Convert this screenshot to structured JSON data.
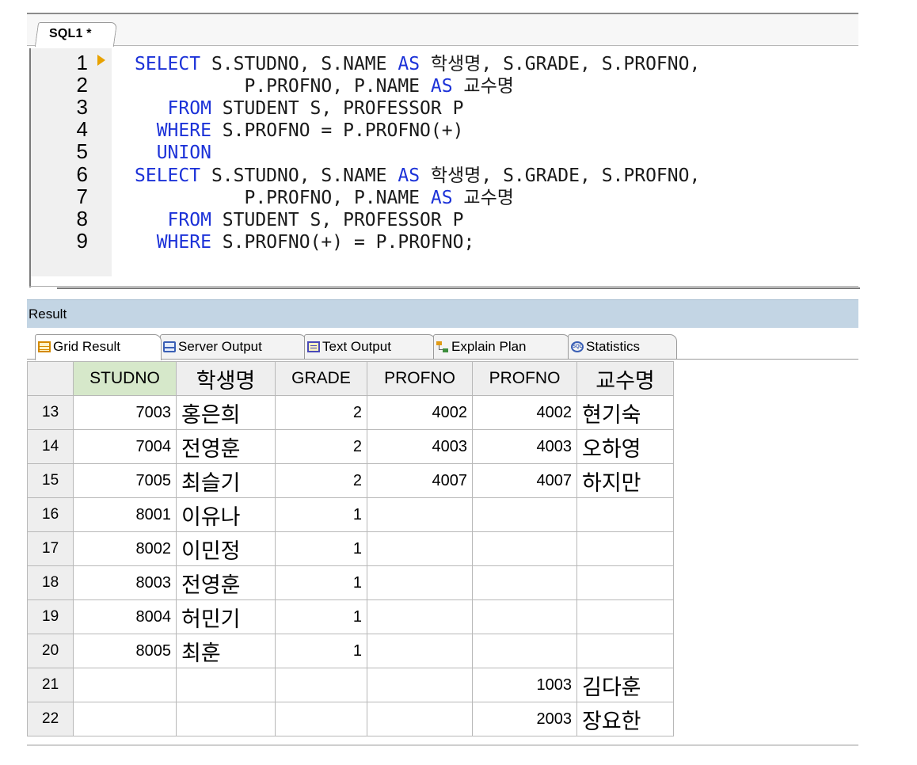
{
  "editor": {
    "tab_label": "SQL1 *",
    "line_numbers": [
      "1",
      "2",
      "3",
      "4",
      "5",
      "6",
      "7",
      "8",
      "9"
    ],
    "lines": [
      [
        {
          "t": "SELECT",
          "kw": true
        },
        {
          "t": " S.STUDNO, S.NAME "
        },
        {
          "t": "AS",
          "kw": true
        },
        {
          "t": " 학생명, S.GRADE, S.PROFNO,"
        }
      ],
      [
        {
          "t": "          P.PROFNO, P.NAME "
        },
        {
          "t": "AS",
          "kw": true
        },
        {
          "t": " 교수명"
        }
      ],
      [
        {
          "t": "   "
        },
        {
          "t": "FROM",
          "kw": true
        },
        {
          "t": " STUDENT S, PROFESSOR P"
        }
      ],
      [
        {
          "t": "  "
        },
        {
          "t": "WHERE",
          "kw": true
        },
        {
          "t": " S.PROFNO = P.PROFNO(+)"
        }
      ],
      [
        {
          "t": "  "
        },
        {
          "t": "UNION",
          "kw": true
        }
      ],
      [
        {
          "t": "SELECT",
          "kw": true
        },
        {
          "t": " S.STUDNO, S.NAME "
        },
        {
          "t": "AS",
          "kw": true
        },
        {
          "t": " 학생명, S.GRADE, S.PROFNO,"
        }
      ],
      [
        {
          "t": "          P.PROFNO, P.NAME "
        },
        {
          "t": "AS",
          "kw": true
        },
        {
          "t": " 교수명"
        }
      ],
      [
        {
          "t": "   "
        },
        {
          "t": "FROM",
          "kw": true
        },
        {
          "t": " STUDENT S, PROFESSOR P"
        }
      ],
      [
        {
          "t": "  "
        },
        {
          "t": "WHERE",
          "kw": true
        },
        {
          "t": " S.PROFNO(+) = P.PROFNO;"
        }
      ]
    ]
  },
  "result": {
    "title": "Result",
    "tabs": [
      {
        "label": "Grid Result",
        "icon": "grid-icon",
        "active": true
      },
      {
        "label": "Server Output",
        "icon": "server-icon",
        "active": false
      },
      {
        "label": "Text Output",
        "icon": "text-icon",
        "active": false
      },
      {
        "label": "Explain Plan",
        "icon": "plan-icon",
        "active": false
      },
      {
        "label": "Statistics",
        "icon": "statistics-icon",
        "active": false
      }
    ],
    "columns": [
      "STUDNO",
      "학생명",
      "GRADE",
      "PROFNO",
      "PROFNO",
      "교수명"
    ],
    "rows": [
      [
        "13",
        "7003",
        "홍은희",
        "2",
        "4002",
        "4002",
        "현기숙"
      ],
      [
        "14",
        "7004",
        "전영훈",
        "2",
        "4003",
        "4003",
        "오하영"
      ],
      [
        "15",
        "7005",
        "최슬기",
        "2",
        "4007",
        "4007",
        "하지만"
      ],
      [
        "16",
        "8001",
        "이유나",
        "1",
        "",
        "",
        ""
      ],
      [
        "17",
        "8002",
        "이민정",
        "1",
        "",
        "",
        ""
      ],
      [
        "18",
        "8003",
        "전영훈",
        "1",
        "",
        "",
        ""
      ],
      [
        "19",
        "8004",
        "허민기",
        "1",
        "",
        "",
        ""
      ],
      [
        "20",
        "8005",
        "최훈",
        "1",
        "",
        "",
        ""
      ],
      [
        "21",
        "",
        "",
        "",
        "",
        "1003",
        "김다훈"
      ],
      [
        "22",
        "",
        "",
        "",
        "",
        "2003",
        "장요한"
      ]
    ]
  },
  "colors": {
    "keyword": "#1c32d8",
    "header_bg": "#c3d5e4",
    "selected_column": "#d6e8ca"
  }
}
